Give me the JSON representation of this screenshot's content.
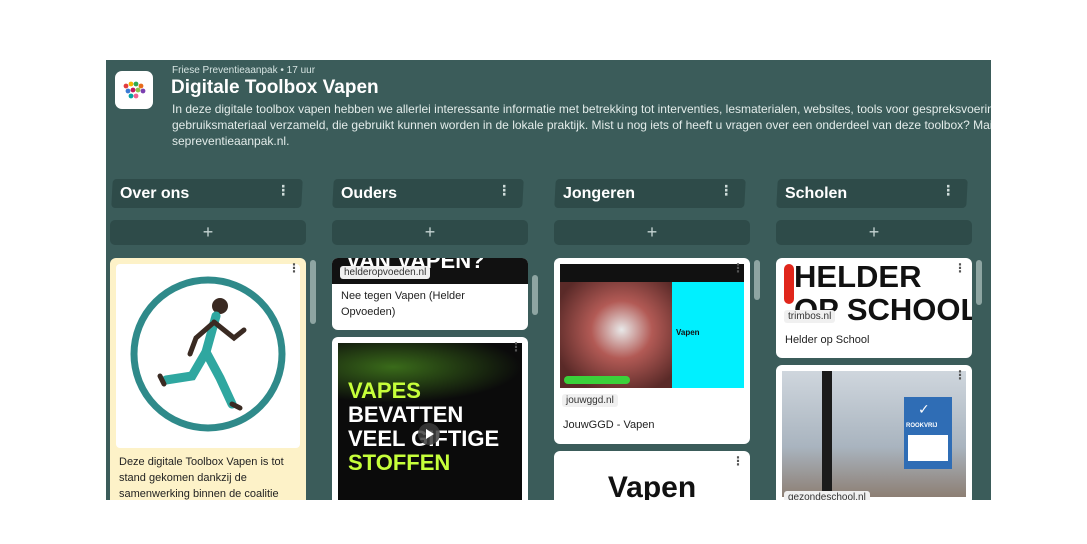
{
  "header": {
    "meta": "Friese Preventieaanpak • 17 uur",
    "title": "Digitale Toolbox Vapen",
    "description_lines": [
      "In deze digitale toolbox vapen hebben we allerlei interessante informatie met betrekking tot interventies, lesmaterialen, websites, tools voor gespreksvoering en ov",
      "gebruiksmateriaal verzameld, die gebruikt kunnen worden in de lokale praktijk. Mist u nog iets of heeft u vragen over een onderdeel van deze toolbox? Mail dan naa",
      "sepreventieaanpak.nl."
    ]
  },
  "columns": [
    {
      "label": "Over ons"
    },
    {
      "label": "Ouders"
    },
    {
      "label": "Jongeren"
    },
    {
      "label": "Scholen"
    }
  ],
  "add_label": "+",
  "menu_glyph": "⋮",
  "cards": {
    "over_ons_1": {
      "text_lines": [
        "Deze digitale Toolbox Vapen is tot",
        "stand gekomen dankzij de",
        "samenwerking binnen de coalitie"
      ]
    },
    "ouders_1": {
      "chip": "helderopvoeden.nl",
      "title_lines": [
        "Nee tegen Vapen (Helder",
        "Opvoeden)"
      ],
      "image_text": "VAN VAPEN?"
    },
    "ouders_2": {
      "image_lines": [
        "VAPES",
        "BEVATTEN",
        "VEEL GIFTIGE",
        "STOFFEN"
      ]
    },
    "jongeren_1": {
      "chip": "jouwggd.nl",
      "title": "JouwGGD - Vapen",
      "image_text": "Vapen"
    },
    "jongeren_2": {
      "image_text": "Vapen"
    },
    "scholen_1": {
      "chip": "trimbos.nl",
      "title": "Helder op School",
      "image_lines": [
        "HELDER",
        "OP SCHOOL"
      ]
    },
    "scholen_2": {
      "chip": "gezondeschool.nl",
      "sign": "ROOKVRIJ"
    }
  },
  "colors": {
    "board_bg": "#3b5c5a",
    "column_header": "#2e4b49",
    "highlight_card": "#fdf2c8",
    "accent_green": "#c6ff3a",
    "accent_cyan": "#00f0ff"
  }
}
